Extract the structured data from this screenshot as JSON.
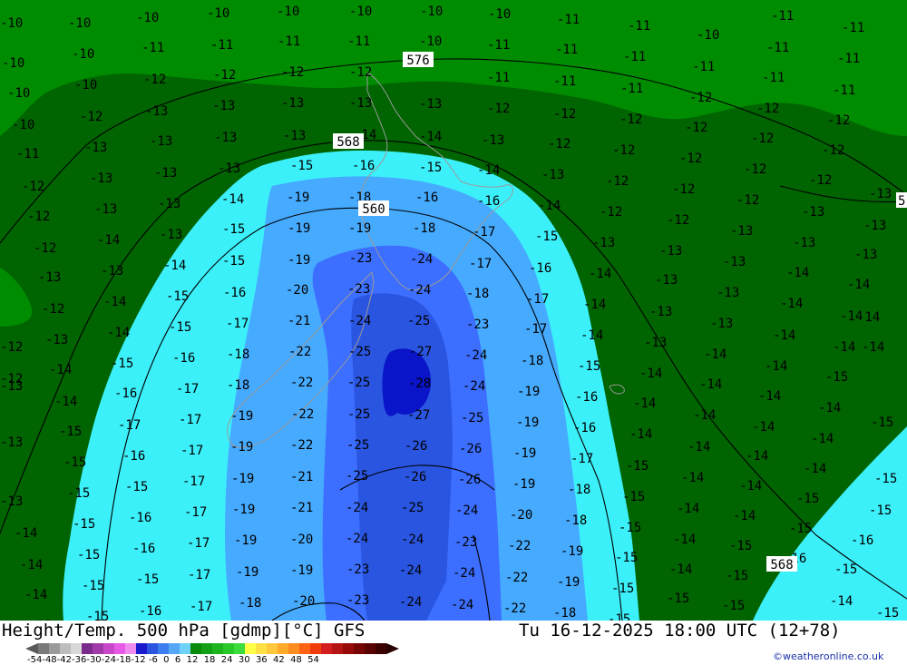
{
  "title_left": "Height/Temp. 500 hPa [gdmp][°C] GFS",
  "title_right": "Tu 16-12-2025 18:00 UTC (12+78)",
  "credit": "©weatheronline.co.uk",
  "legend": {
    "tick_labels": "-54-48-42-36-30-24-18-12 -6  0  6  12  18  24  30  36  42  48  54",
    "colors": [
      "#7a7a7a",
      "#9a9a9a",
      "#bdbdbd",
      "#d8d8d8",
      "#7a2a8a",
      "#a03aa8",
      "#c846c8",
      "#e65ae6",
      "#f08cf0",
      "#1a1acc",
      "#2a55e0",
      "#3c7ef0",
      "#55a8f5",
      "#6ed2fa",
      "#0a8a0a",
      "#14a014",
      "#1eb41e",
      "#28c828",
      "#3cdc3c",
      "#ffff46",
      "#ffe146",
      "#ffc83c",
      "#ffaa28",
      "#ff8c1e",
      "#ff6414",
      "#f03c0a",
      "#d21e1e",
      "#b41414",
      "#960a0a",
      "#780505",
      "#5a0303",
      "#3c0202"
    ]
  },
  "contour_labels": [
    "576",
    "568",
    "560",
    "568",
    "5"
  ],
  "colors": {
    "green_dark": "#006400",
    "green": "#008c00",
    "cyan": "#3cf0fa",
    "blue_light": "#46aaff",
    "blue": "#3c6eff",
    "blue_core": "#0a14c8"
  },
  "temps": [
    [
      "-10",
      0,
      18
    ],
    [
      "-10",
      75,
      18
    ],
    [
      "-10",
      150,
      12
    ],
    [
      "-10",
      228,
      7
    ],
    [
      "-10",
      305,
      5
    ],
    [
      "-10",
      385,
      5
    ],
    [
      "-10",
      463,
      5
    ],
    [
      "-10",
      538,
      8
    ],
    [
      "-11",
      614,
      14
    ],
    [
      "-11",
      692,
      21
    ],
    [
      "-10",
      768,
      31
    ],
    [
      "-11",
      850,
      10
    ],
    [
      "-11",
      928,
      23
    ],
    [
      "-10",
      2,
      62
    ],
    [
      "-10",
      79,
      52
    ],
    [
      "-11",
      156,
      45
    ],
    [
      "-11",
      232,
      42
    ],
    [
      "-11",
      306,
      38
    ],
    [
      "-11",
      383,
      38
    ],
    [
      "-10",
      462,
      38
    ],
    [
      "-11",
      537,
      42
    ],
    [
      "-11",
      612,
      47
    ],
    [
      "-11",
      687,
      55
    ],
    [
      "-11",
      763,
      66
    ],
    [
      "-11",
      845,
      45
    ],
    [
      "-11",
      923,
      57
    ],
    [
      "-10",
      8,
      95
    ],
    [
      "-10",
      82,
      86
    ],
    [
      "-12",
      158,
      80
    ],
    [
      "-12",
      235,
      75
    ],
    [
      "-12",
      310,
      72
    ],
    [
      "-12",
      385,
      72
    ],
    [
      "-11",
      537,
      78
    ],
    [
      "-11",
      610,
      82
    ],
    [
      "-11",
      684,
      90
    ],
    [
      "-12",
      760,
      100
    ],
    [
      "-11",
      840,
      78
    ],
    [
      "-11",
      918,
      92
    ],
    [
      "-10",
      13,
      130
    ],
    [
      "-12",
      88,
      121
    ],
    [
      "-13",
      160,
      115
    ],
    [
      "-13",
      234,
      109
    ],
    [
      "-13",
      310,
      106
    ],
    [
      "-13",
      385,
      106
    ],
    [
      "-13",
      462,
      107
    ],
    [
      "-12",
      537,
      112
    ],
    [
      "-12",
      610,
      118
    ],
    [
      "-12",
      683,
      124
    ],
    [
      "-12",
      755,
      133
    ],
    [
      "-12",
      834,
      112
    ],
    [
      "-12",
      912,
      125
    ],
    [
      "-11",
      18,
      162
    ],
    [
      "-13",
      93,
      155
    ],
    [
      "-13",
      165,
      148
    ],
    [
      "-13",
      236,
      144
    ],
    [
      "-13",
      312,
      142
    ],
    [
      "-14",
      390,
      141
    ],
    [
      "-14",
      462,
      143
    ],
    [
      "-13",
      531,
      147
    ],
    [
      "-12",
      604,
      151
    ],
    [
      "-12",
      675,
      158
    ],
    [
      "-12",
      749,
      167
    ],
    [
      "-12",
      828,
      145
    ],
    [
      "-12",
      906,
      158
    ],
    [
      "-12",
      24,
      198
    ],
    [
      "-13",
      99,
      189
    ],
    [
      "-13",
      170,
      183
    ],
    [
      "-13",
      240,
      178
    ],
    [
      "-15",
      320,
      175
    ],
    [
      "-16",
      388,
      175
    ],
    [
      "-15",
      462,
      177
    ],
    [
      "-14",
      526,
      180
    ],
    [
      "-13",
      597,
      185
    ],
    [
      "-12",
      668,
      192
    ],
    [
      "-12",
      741,
      201
    ],
    [
      "-12",
      820,
      179
    ],
    [
      "-12",
      892,
      191
    ],
    [
      "-13",
      958,
      206
    ],
    [
      "-12",
      30,
      231
    ],
    [
      "-13",
      104,
      223
    ],
    [
      "-13",
      174,
      217
    ],
    [
      "-14",
      244,
      212
    ],
    [
      "-19",
      316,
      210
    ],
    [
      "-18",
      384,
      210
    ],
    [
      "-16",
      458,
      210
    ],
    [
      "-16",
      526,
      214
    ],
    [
      "-14",
      593,
      219
    ],
    [
      "-12",
      661,
      226
    ],
    [
      "-12",
      735,
      235
    ],
    [
      "-12",
      812,
      213
    ],
    [
      "-13",
      884,
      226
    ],
    [
      "-13",
      952,
      241
    ],
    [
      "-12",
      37,
      266
    ],
    [
      "-14",
      107,
      257
    ],
    [
      "-13",
      176,
      251
    ],
    [
      "-15",
      245,
      245
    ],
    [
      "-19",
      317,
      244
    ],
    [
      "-19",
      384,
      244
    ],
    [
      "-18",
      455,
      244
    ],
    [
      "-17",
      521,
      248
    ],
    [
      "-15",
      590,
      253
    ],
    [
      "-13",
      653,
      260
    ],
    [
      "-13",
      727,
      269
    ],
    [
      "-13",
      805,
      247
    ],
    [
      "-13",
      874,
      260
    ],
    [
      "-13",
      942,
      273
    ],
    [
      "-13",
      42,
      298
    ],
    [
      "-13",
      111,
      291
    ],
    [
      "-14",
      180,
      285
    ],
    [
      "-15",
      245,
      280
    ],
    [
      "-19",
      317,
      279
    ],
    [
      "-23",
      385,
      277
    ],
    [
      "-24",
      452,
      278
    ],
    [
      "-17",
      517,
      283
    ],
    [
      "-16",
      583,
      288
    ],
    [
      "-14",
      649,
      294
    ],
    [
      "-13",
      722,
      301
    ],
    [
      "-13",
      797,
      281
    ],
    [
      "-14",
      867,
      293
    ],
    [
      "-14",
      934,
      306
    ],
    [
      "-12",
      46,
      333
    ],
    [
      "-14",
      114,
      325
    ],
    [
      "-15",
      183,
      319
    ],
    [
      "-16",
      246,
      315
    ],
    [
      "-20",
      315,
      312
    ],
    [
      "-23",
      383,
      311
    ],
    [
      "-24",
      450,
      312
    ],
    [
      "-18",
      514,
      316
    ],
    [
      "-17",
      580,
      322
    ],
    [
      "-14",
      643,
      328
    ],
    [
      "-13",
      716,
      336
    ],
    [
      "-13",
      790,
      315
    ],
    [
      "-14",
      860,
      327
    ],
    [
      "-14",
      926,
      341
    ],
    [
      "-13",
      50,
      367
    ],
    [
      "-14",
      118,
      359
    ],
    [
      "-15",
      186,
      353
    ],
    [
      "-17",
      249,
      349
    ],
    [
      "-21",
      317,
      346
    ],
    [
      "-24",
      384,
      346
    ],
    [
      "-25",
      449,
      346
    ],
    [
      "-23",
      514,
      350
    ],
    [
      "-17",
      578,
      355
    ],
    [
      "-14",
      640,
      362
    ],
    [
      "-13",
      710,
      370
    ],
    [
      "-13",
      783,
      349
    ],
    [
      "-14",
      852,
      362
    ],
    [
      "-14",
      918,
      375
    ],
    [
      "-14",
      54,
      400
    ],
    [
      "-15",
      122,
      393
    ],
    [
      "-16",
      190,
      387
    ],
    [
      "-18",
      250,
      383
    ],
    [
      "-22",
      318,
      380
    ],
    [
      "-25",
      384,
      380
    ],
    [
      "-27",
      451,
      380
    ],
    [
      "-24",
      512,
      384
    ],
    [
      "-18",
      574,
      390
    ],
    [
      "-15",
      637,
      396
    ],
    [
      "-14",
      705,
      404
    ],
    [
      "-14",
      776,
      383
    ],
    [
      "-14",
      843,
      396
    ],
    [
      "-15",
      910,
      408
    ],
    [
      "-14",
      60,
      435
    ],
    [
      "-16",
      126,
      426
    ],
    [
      "-17",
      194,
      421
    ],
    [
      "-18",
      250,
      417
    ],
    [
      "-22",
      320,
      414
    ],
    [
      "-25",
      383,
      414
    ],
    [
      "-28",
      450,
      415
    ],
    [
      "-24",
      510,
      418
    ],
    [
      "-19",
      570,
      424
    ],
    [
      "-16",
      634,
      430
    ],
    [
      "-14",
      698,
      437
    ],
    [
      "-14",
      771,
      416
    ],
    [
      "-14",
      836,
      429
    ],
    [
      "-14",
      902,
      442
    ],
    [
      "-15",
      65,
      468
    ],
    [
      "-17",
      130,
      461
    ],
    [
      "-17",
      197,
      455
    ],
    [
      "-19",
      254,
      451
    ],
    [
      "-22",
      321,
      449
    ],
    [
      "-25",
      383,
      449
    ],
    [
      "-27",
      449,
      450
    ],
    [
      "-25",
      508,
      453
    ],
    [
      "-19",
      569,
      458
    ],
    [
      "-16",
      632,
      464
    ],
    [
      "-14",
      694,
      471
    ],
    [
      "-14",
      764,
      450
    ],
    [
      "-14",
      829,
      463
    ],
    [
      "-14",
      894,
      476
    ],
    [
      "-15",
      70,
      502
    ],
    [
      "-16",
      135,
      495
    ],
    [
      "-17",
      199,
      489
    ],
    [
      "-19",
      254,
      485
    ],
    [
      "-22",
      320,
      483
    ],
    [
      "-25",
      382,
      483
    ],
    [
      "-26",
      446,
      484
    ],
    [
      "-26",
      506,
      487
    ],
    [
      "-19",
      566,
      492
    ],
    [
      "-17",
      629,
      498
    ],
    [
      "-15",
      690,
      506
    ],
    [
      "-14",
      758,
      485
    ],
    [
      "-14",
      822,
      495
    ],
    [
      "-14",
      886,
      509
    ],
    [
      "-15",
      74,
      536
    ],
    [
      "-15",
      138,
      529
    ],
    [
      "-17",
      201,
      523
    ],
    [
      "-19",
      255,
      520
    ],
    [
      "-21",
      320,
      518
    ],
    [
      "-25",
      381,
      517
    ],
    [
      "-26",
      445,
      518
    ],
    [
      "-26",
      505,
      521
    ],
    [
      "-19",
      565,
      526
    ],
    [
      "-18",
      626,
      532
    ],
    [
      "-15",
      686,
      540
    ],
    [
      "-14",
      751,
      519
    ],
    [
      "-14",
      815,
      528
    ],
    [
      "-15",
      878,
      542
    ],
    [
      "-15",
      80,
      570
    ],
    [
      "-16",
      142,
      563
    ],
    [
      "-17",
      203,
      557
    ],
    [
      "-19",
      256,
      554
    ],
    [
      "-21",
      320,
      552
    ],
    [
      "-24",
      381,
      552
    ],
    [
      "-25",
      442,
      552
    ],
    [
      "-24",
      502,
      555
    ],
    [
      "-20",
      562,
      560
    ],
    [
      "-18",
      622,
      566
    ],
    [
      "-15",
      682,
      574
    ],
    [
      "-14",
      746,
      553
    ],
    [
      "-14",
      808,
      561
    ],
    [
      "-15",
      870,
      575
    ],
    [
      "-14",
      16,
      580
    ],
    [
      "-15",
      85,
      604
    ],
    [
      "-16",
      146,
      597
    ],
    [
      "-17",
      206,
      591
    ],
    [
      "-19",
      258,
      588
    ],
    [
      "-20",
      320,
      587
    ],
    [
      "-24",
      381,
      586
    ],
    [
      "-24",
      442,
      587
    ],
    [
      "-23",
      501,
      590
    ],
    [
      "-22",
      560,
      594
    ],
    [
      "-19",
      618,
      600
    ],
    [
      "-15",
      678,
      607
    ],
    [
      "-14",
      742,
      587
    ],
    [
      "-15",
      804,
      594
    ],
    [
      "-16",
      864,
      608
    ],
    [
      "-14",
      22,
      615
    ],
    [
      "-15",
      90,
      638
    ],
    [
      "-15",
      150,
      631
    ],
    [
      "-17",
      207,
      626
    ],
    [
      "-19",
      260,
      623
    ],
    [
      "-19",
      320,
      621
    ],
    [
      "-23",
      382,
      620
    ],
    [
      "-24",
      440,
      621
    ],
    [
      "-24",
      499,
      624
    ],
    [
      "-22",
      557,
      629
    ],
    [
      "-19",
      614,
      634
    ],
    [
      "-15",
      674,
      641
    ],
    [
      "-14",
      738,
      620
    ],
    [
      "-15",
      800,
      627
    ],
    [
      "-15",
      920,
      620
    ],
    [
      "-14",
      27,
      648
    ],
    [
      "-15",
      95,
      672
    ],
    [
      "-16",
      153,
      666
    ],
    [
      "-17",
      209,
      661
    ],
    [
      "-18",
      263,
      657
    ],
    [
      "-20",
      322,
      655
    ],
    [
      "-23",
      382,
      654
    ],
    [
      "-24",
      440,
      656
    ],
    [
      "-24",
      497,
      659
    ],
    [
      "-22",
      555,
      663
    ],
    [
      "-18",
      610,
      668
    ],
    [
      "-15",
      670,
      675
    ],
    [
      "-15",
      735,
      652
    ],
    [
      "-15",
      796,
      660
    ],
    [
      "-14",
      915,
      655
    ],
    [
      "-15",
      32,
      682
    ],
    [
      "-13",
      0,
      418
    ],
    [
      "-12",
      0,
      375
    ],
    [
      "-13",
      0,
      480
    ],
    [
      "-13",
      0,
      545
    ],
    [
      "-12",
      0,
      410
    ],
    [
      "-15",
      960,
      458
    ],
    [
      "-15",
      964,
      520
    ],
    [
      "-15",
      958,
      555
    ],
    [
      "-16",
      938,
      588
    ],
    [
      "-15",
      966,
      668
    ],
    [
      "-14",
      950,
      375
    ],
    [
      "-14",
      945,
      342
    ]
  ]
}
